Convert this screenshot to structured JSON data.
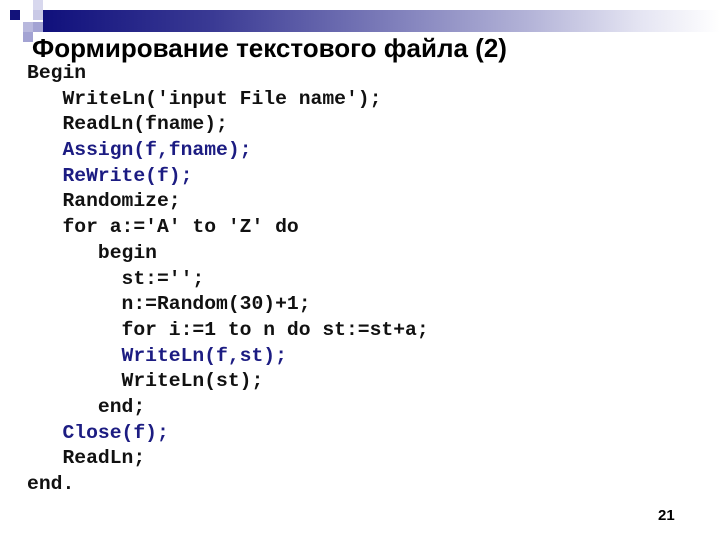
{
  "slide": {
    "title": "Формирование текстового файла (2)",
    "page_number": "21",
    "colors": {
      "accent_dark": "#10107c",
      "code_highlight": "#1c1c82",
      "code_text": "#111111"
    },
    "code_lines": [
      {
        "text": "Begin",
        "highlight": false
      },
      {
        "text": "   WriteLn('input File name');",
        "highlight": false
      },
      {
        "text": "   ReadLn(fname);",
        "highlight": false
      },
      {
        "text": "   Assign(f,fname);",
        "highlight": true
      },
      {
        "text": "   ReWrite(f);",
        "highlight": true
      },
      {
        "text": "   Randomize;",
        "highlight": false
      },
      {
        "text": "   for a:='A' to 'Z' do",
        "highlight": false
      },
      {
        "text": "      begin",
        "highlight": false
      },
      {
        "text": "        st:='';",
        "highlight": false
      },
      {
        "text": "        n:=Random(30)+1;",
        "highlight": false
      },
      {
        "text": "        for i:=1 to n do st:=st+a;",
        "highlight": false
      },
      {
        "text": "        WriteLn(f,st);",
        "highlight": true
      },
      {
        "text": "        WriteLn(st);",
        "highlight": false
      },
      {
        "text": "      end;",
        "highlight": false
      },
      {
        "text": "   Close(f);",
        "highlight": true
      },
      {
        "text": "   ReadLn;",
        "highlight": false
      },
      {
        "text": "end.",
        "highlight": false
      }
    ]
  }
}
